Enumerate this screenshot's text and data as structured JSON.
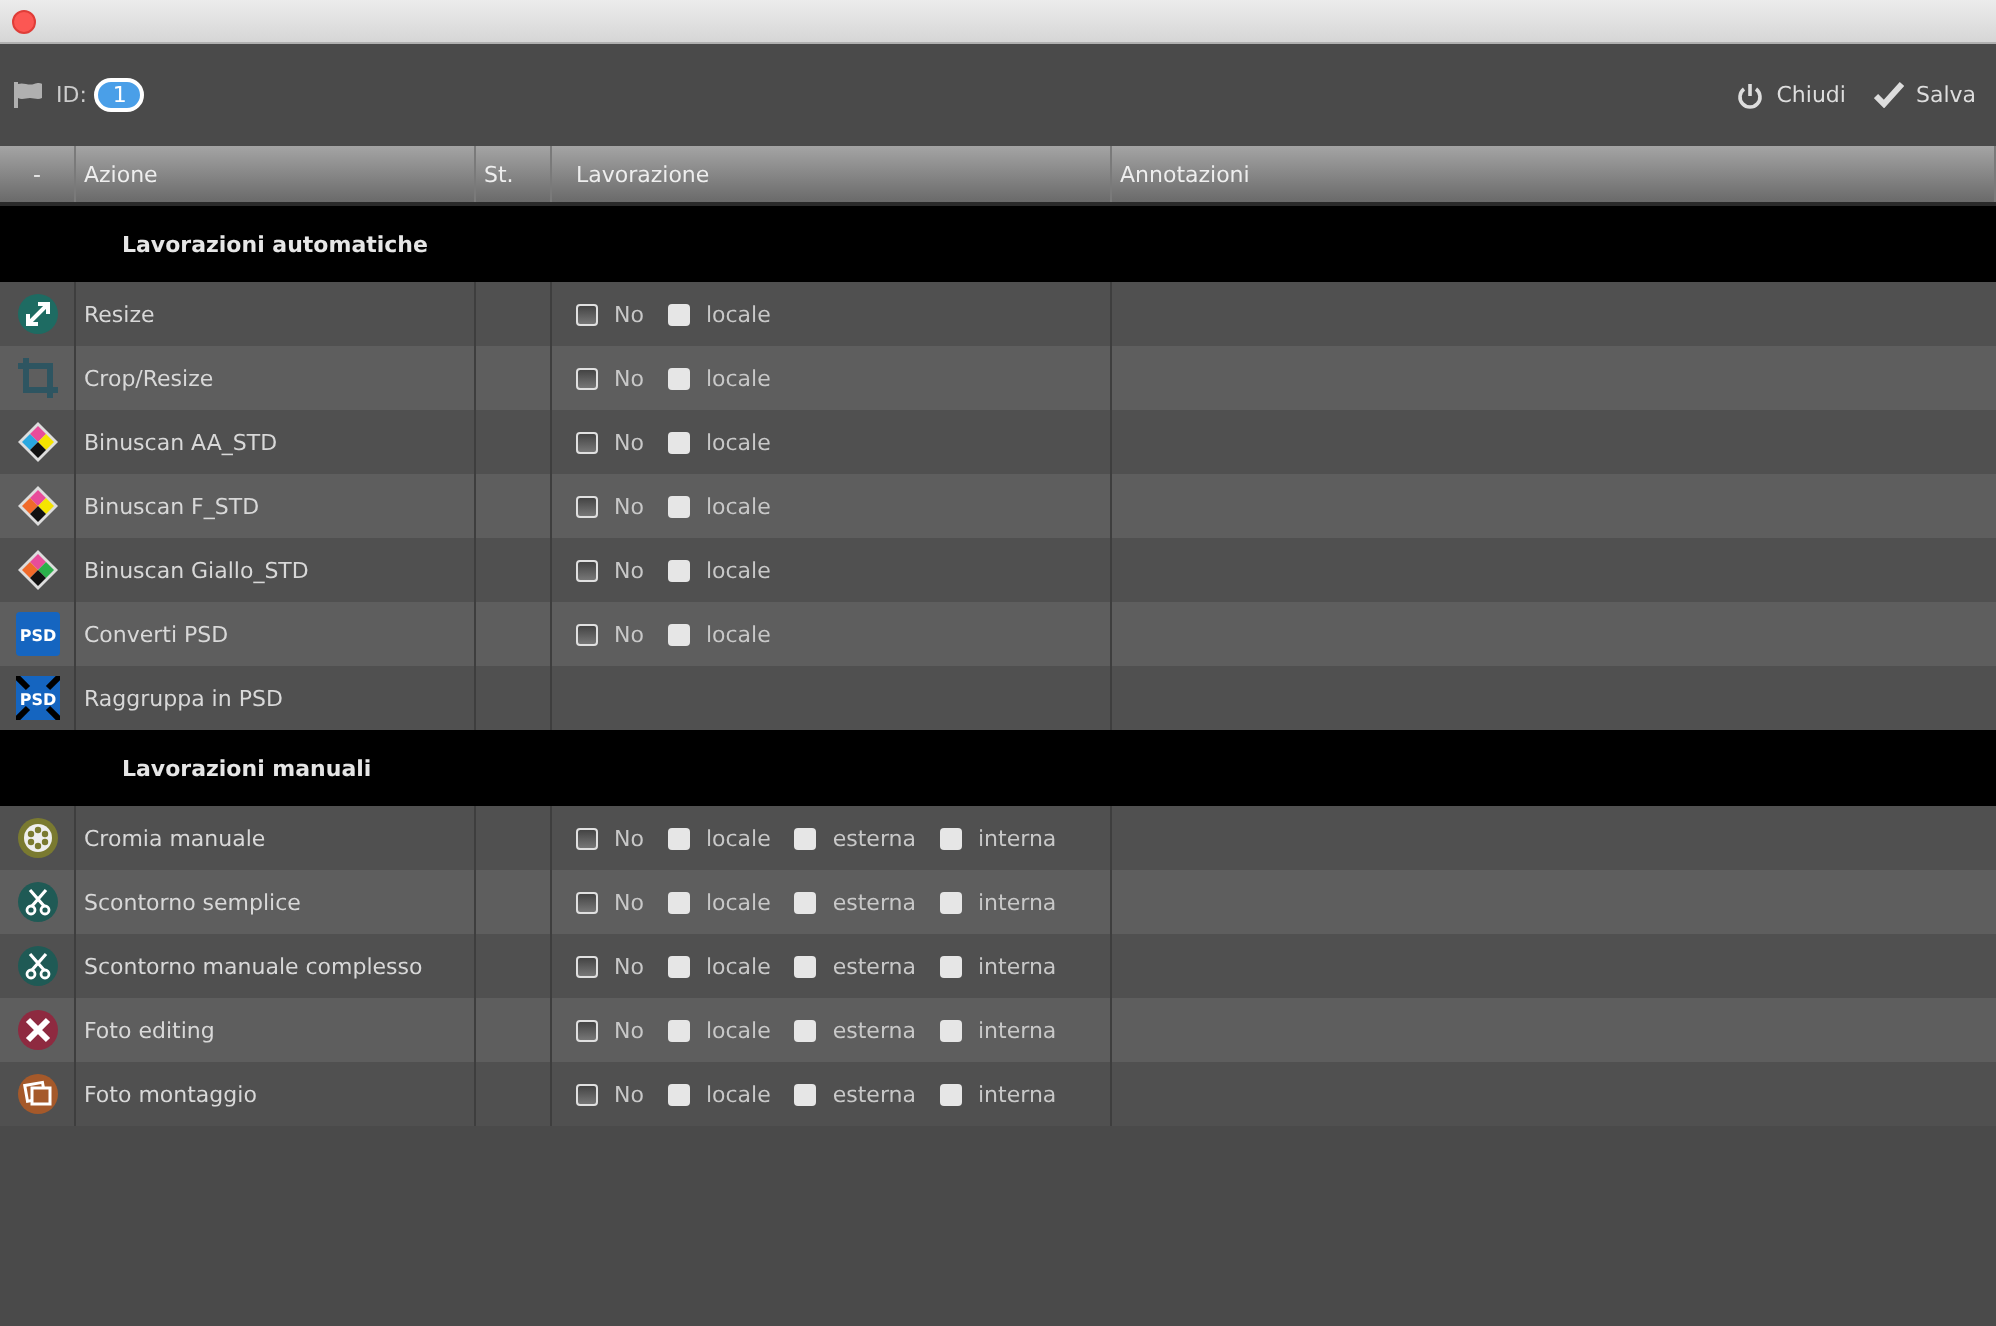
{
  "toolbar": {
    "id_label": "ID:",
    "id_value": "1",
    "actions": [
      {
        "kind": "close",
        "label": "Chiudi"
      },
      {
        "kind": "save",
        "label": "Salva"
      }
    ]
  },
  "table": {
    "columns": [
      "-",
      "Azione",
      "St.",
      "Lavorazione",
      "Annotazioni"
    ],
    "groups": [
      {
        "title": "Lavorazioni automatiche",
        "rows": [
          {
            "action": "Resize",
            "options": [
              {
                "kind": "none",
                "label": "No",
                "checked": false
              },
              {
                "kind": "place",
                "label": "locale",
                "checked": false
              }
            ]
          },
          {
            "action": "Crop/Resize",
            "options": [
              {
                "kind": "none",
                "label": "No",
                "checked": false
              },
              {
                "kind": "place",
                "label": "locale",
                "checked": false
              }
            ]
          },
          {
            "action": "Binuscan AA_STD",
            "options": [
              {
                "kind": "none",
                "label": "No",
                "checked": false
              },
              {
                "kind": "place",
                "label": "locale",
                "checked": false
              }
            ]
          },
          {
            "action": "Binuscan F_STD",
            "options": [
              {
                "kind": "none",
                "label": "No",
                "checked": false
              },
              {
                "kind": "place",
                "label": "locale",
                "checked": false
              }
            ]
          },
          {
            "action": "Binuscan Giallo_STD",
            "options": [
              {
                "kind": "none",
                "label": "No",
                "checked": false
              },
              {
                "kind": "place",
                "label": "locale",
                "checked": false
              }
            ]
          },
          {
            "action": "Converti PSD",
            "icon_text": "PSD",
            "options": [
              {
                "kind": "none",
                "label": "No",
                "checked": false
              },
              {
                "kind": "place",
                "label": "locale",
                "checked": false
              }
            ]
          },
          {
            "action": "Raggruppa in PSD",
            "icon_text": "PSD",
            "options": []
          }
        ]
      },
      {
        "title": "Lavorazioni manuali",
        "rows": [
          {
            "action": "Cromia manuale",
            "options": [
              {
                "kind": "none",
                "label": "No",
                "checked": false
              },
              {
                "kind": "place",
                "label": "locale",
                "checked": false
              },
              {
                "kind": "place",
                "label": "esterna",
                "checked": false
              },
              {
                "kind": "place",
                "label": "interna",
                "checked": false
              }
            ]
          },
          {
            "action": "Scontorno semplice",
            "options": [
              {
                "kind": "none",
                "label": "No",
                "checked": false
              },
              {
                "kind": "place",
                "label": "locale",
                "checked": false
              },
              {
                "kind": "place",
                "label": "esterna",
                "checked": false
              },
              {
                "kind": "place",
                "label": "interna",
                "checked": false
              }
            ]
          },
          {
            "action": "Scontorno manuale complesso",
            "options": [
              {
                "kind": "none",
                "label": "No",
                "checked": false
              },
              {
                "kind": "place",
                "label": "locale",
                "checked": false
              },
              {
                "kind": "place",
                "label": "esterna",
                "checked": false
              },
              {
                "kind": "place",
                "label": "interna",
                "checked": false
              }
            ]
          },
          {
            "action": "Foto editing",
            "options": [
              {
                "kind": "none",
                "label": "No",
                "checked": false
              },
              {
                "kind": "place",
                "label": "locale",
                "checked": false
              },
              {
                "kind": "place",
                "label": "esterna",
                "checked": false
              },
              {
                "kind": "place",
                "label": "interna",
                "checked": false
              }
            ]
          },
          {
            "action": "Foto montaggio",
            "options": [
              {
                "kind": "none",
                "label": "No",
                "checked": false
              },
              {
                "kind": "place",
                "label": "locale",
                "checked": false
              },
              {
                "kind": "place",
                "label": "esterna",
                "checked": false
              },
              {
                "kind": "place",
                "label": "interna",
                "checked": false
              }
            ]
          }
        ]
      }
    ]
  }
}
